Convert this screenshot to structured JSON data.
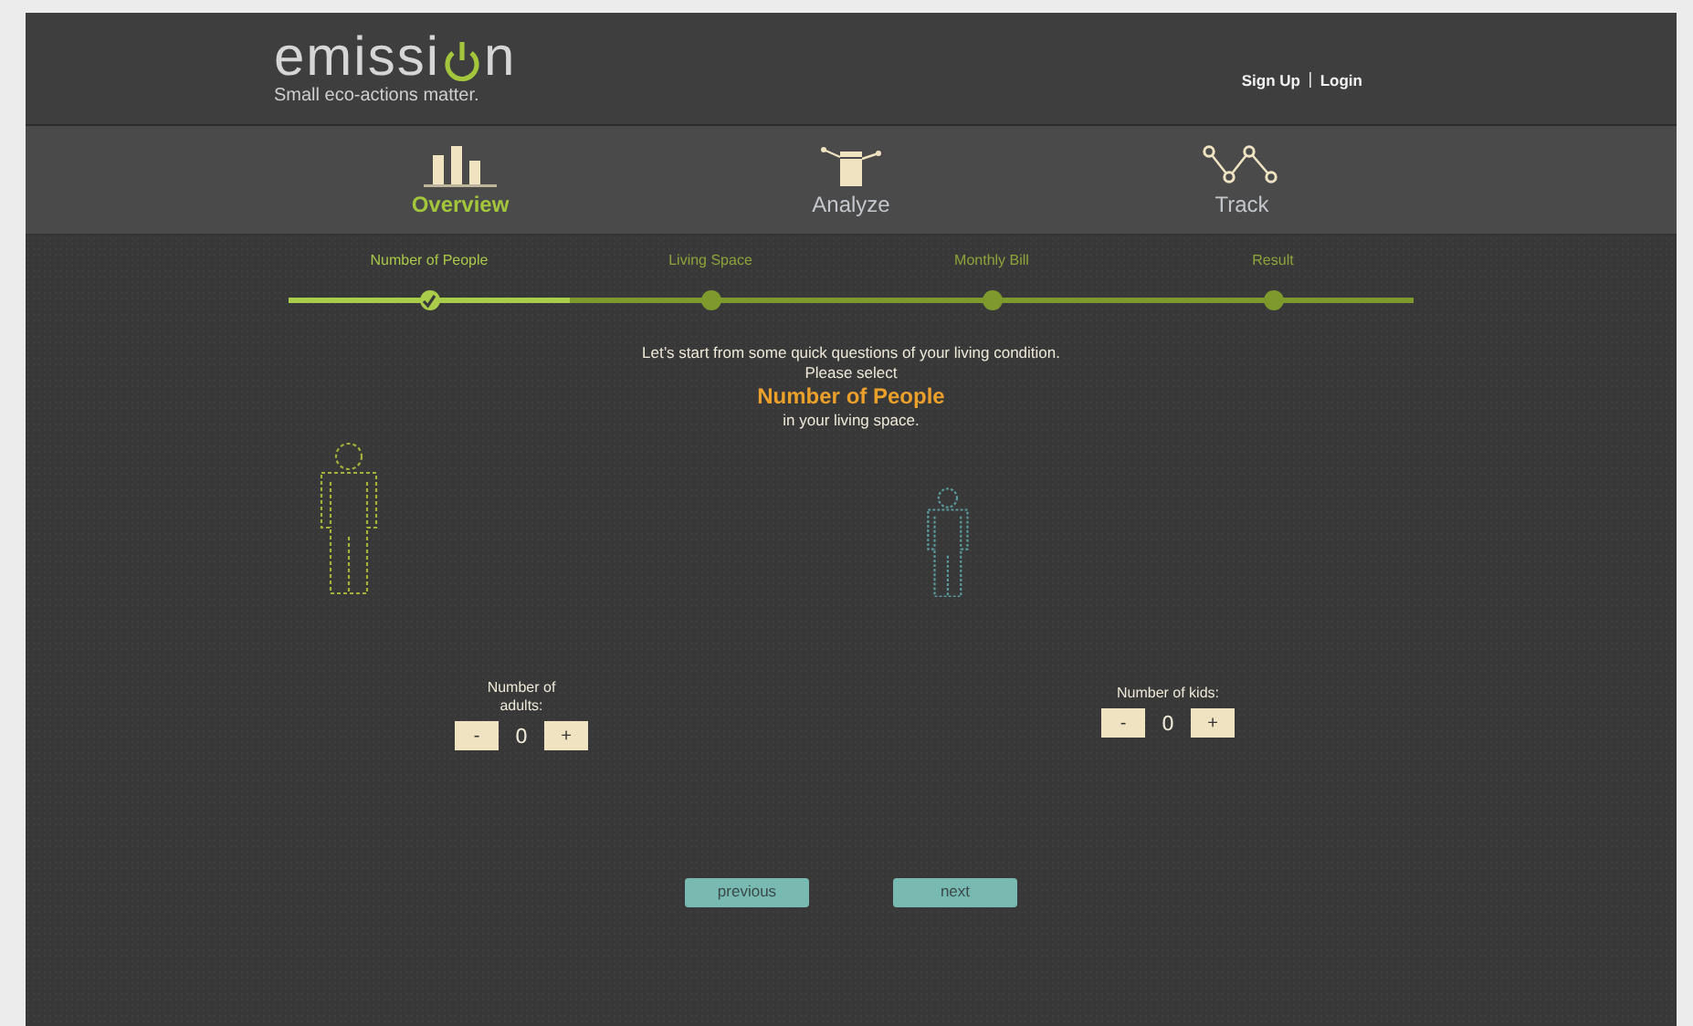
{
  "header": {
    "logo_start": "emissi",
    "logo_end": "n",
    "tagline": "Small eco-actions matter.",
    "auth_links": [
      {
        "label": "Sign Up"
      },
      {
        "label": "Login"
      }
    ],
    "auth_separator": "|"
  },
  "nav": [
    {
      "label": "Overview",
      "kind": "bars",
      "selected": true
    },
    {
      "label": "Analyze",
      "kind": "box",
      "selected": false
    },
    {
      "label": "Track",
      "kind": "zigzag",
      "selected": false
    }
  ],
  "progress": {
    "level": 0.25,
    "steps": [
      {
        "label": "Number of People",
        "done": true
      },
      {
        "label": "Living Space",
        "done": false
      },
      {
        "label": "Monthly Bill",
        "done": false
      },
      {
        "label": "Result",
        "done": false
      }
    ]
  },
  "intro": {
    "line_1": "Let’s start from some quick questions of your living condition.",
    "line_2": "Please select",
    "highlight": "Number of People",
    "line_3": "in your living space."
  },
  "counters": [
    {
      "kind": "adult",
      "label": "Number of adults:",
      "value": "0",
      "minus": "-",
      "plus": "+"
    },
    {
      "kind": "kid",
      "label": "Number of kids:",
      "value": "0",
      "minus": "-",
      "plus": "+"
    }
  ],
  "buttons": [
    {
      "label": "previous"
    },
    {
      "label": "next"
    }
  ]
}
